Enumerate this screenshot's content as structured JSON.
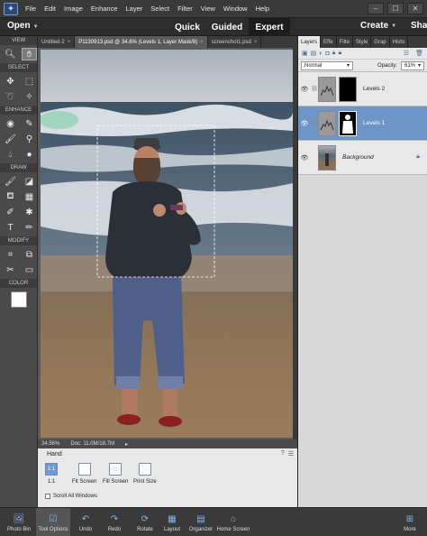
{
  "menu": [
    "File",
    "Edit",
    "Image",
    "Enhance",
    "Layer",
    "Select",
    "Filter",
    "View",
    "Window",
    "Help"
  ],
  "window": {
    "min": "–",
    "max": "☐",
    "close": "✕"
  },
  "modebar": {
    "open": "Open",
    "quick": "Quick",
    "guided": "Guided",
    "expert": "Expert",
    "create": "Create",
    "share": "Sha"
  },
  "toolbox": {
    "sections": {
      "view": "VIEW",
      "select": "SELECT",
      "enhance": "ENHANCE",
      "draw": "DRAW",
      "modify": "MODIFY",
      "color": "COLOR"
    }
  },
  "doc_tabs": [
    {
      "label": "Untitled-2"
    },
    {
      "label": "P1130913.psd @ 34.6% (Levels 1, Layer Mask/8)"
    },
    {
      "label": "screenshot1.psd"
    }
  ],
  "status": {
    "zoom": "34.56%",
    "doc": "Doc: 11.0M/18.7M"
  },
  "tool_options": {
    "title": "Hand",
    "buttons": [
      {
        "icon": "1:1",
        "label": "1:1"
      },
      {
        "icon": "",
        "label": "Fit Screen"
      },
      {
        "icon": "",
        "label": "Fill Screen"
      },
      {
        "icon": "",
        "label": "Print Size"
      }
    ],
    "scroll_all": "Scroll All Windows"
  },
  "panel": {
    "tabs": [
      "Layers",
      "Effe",
      "Filte",
      "Style",
      "Grap",
      "Histo"
    ],
    "blend_mode": "Normal",
    "opacity_label": "Opacity:",
    "opacity_value": "61%",
    "layers": [
      {
        "name": "Levels 2",
        "selected": false
      },
      {
        "name": "Levels 1",
        "selected": true
      },
      {
        "name": "Background",
        "selected": false
      }
    ]
  },
  "bottombar": {
    "items": [
      "Photo Bin",
      "Tool Options",
      "Undo",
      "Redo",
      "Rotate",
      "Layout",
      "Organizer",
      "Home Screen",
      "More"
    ]
  },
  "colors": {
    "accent": "#6d95c8",
    "sky": "#b6bcc4",
    "sand": "#8a7055"
  }
}
